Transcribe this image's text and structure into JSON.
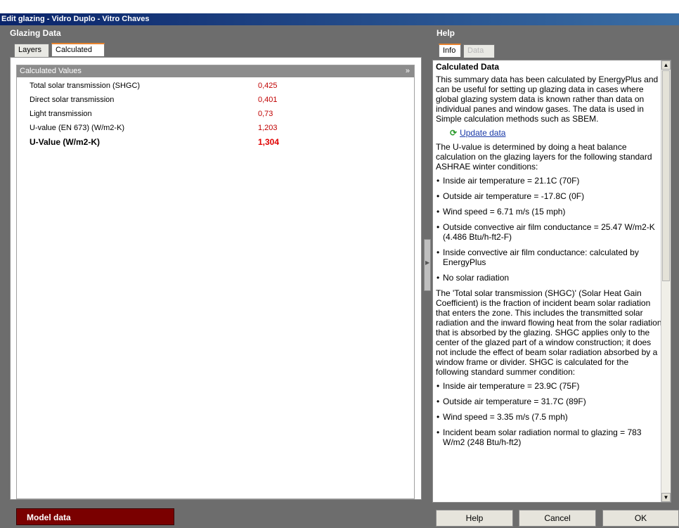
{
  "window": {
    "title": "Edit glazing - Vidro Duplo - Vitro Chaves"
  },
  "left": {
    "header": "Glazing Data",
    "tabs": [
      {
        "label": "Layers"
      },
      {
        "label": "Calculated"
      }
    ],
    "section_title": "Calculated Values",
    "rows": [
      {
        "label": "Total solar transmission (SHGC)",
        "value": "0,425"
      },
      {
        "label": "Direct solar transmission",
        "value": "0,401"
      },
      {
        "label": "Light transmission",
        "value": "0,73"
      },
      {
        "label": "U-value (EN 673) (W/m2-K)",
        "value": "1,203"
      },
      {
        "label": "U-Value (W/m2-K)",
        "value": "1,304"
      }
    ]
  },
  "right": {
    "header": "Help",
    "tabs": [
      {
        "label": "Info"
      },
      {
        "label": "Data"
      }
    ],
    "title": "Calculated Data",
    "intro": "This summary data has been calculated by EnergyPlus and can be useful for setting up glazing data in cases where global glazing system data is known rather than data on individual panes and window gases. The data is used in Simple calculation methods such as SBEM.",
    "update_link": "Update data",
    "uvalue_text": "The U-value is determined by doing a heat balance calculation on the glazing layers for the following standard ASHRAE winter conditions:",
    "winter": [
      "Inside air temperature = 21.1C (70F)",
      "Outside air temperature = -17.8C (0F)",
      "Wind speed = 6.71 m/s (15 mph)",
      "Outside convective air film conductance = 25.47 W/m2-K (4.486 Btu/h-ft2-F)",
      "Inside convective air film conductance: calculated by EnergyPlus",
      "No solar radiation"
    ],
    "shgc_text": "The 'Total solar transmission (SHGC)' (Solar Heat Gain Coefficient) is the fraction of incident beam solar radiation that enters the zone. This includes the transmitted solar radiation and the inward flowing heat from the solar radiation that is absorbed by the glazing. SHGC applies only to the center of the glazed part of a window construction; it does not include the effect of beam solar radiation absorbed by a window frame or divider. SHGC is calculated for the following standard summer condition:",
    "summer": [
      "Inside air temperature = 23.9C (75F)",
      "Outside air temperature = 31.7C (89F)",
      "Wind speed = 3.35 m/s (7.5 mph)",
      "Incident beam solar radiation normal to glazing = 783 W/m2 (248 Btu/h-ft2)"
    ]
  },
  "footer": {
    "model_data": "Model data",
    "help": "Help",
    "cancel": "Cancel",
    "ok": "OK"
  }
}
